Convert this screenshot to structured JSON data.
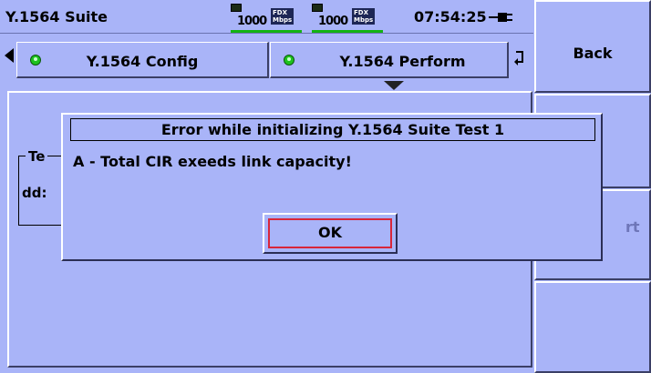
{
  "status_bar": {
    "app_title": "Y.1564 Suite",
    "ports": [
      {
        "speed": "1000",
        "duplex": "FDX",
        "units": "Mbps"
      },
      {
        "speed": "1000",
        "duplex": "FDX",
        "units": "Mbps"
      }
    ],
    "clock": "07:54:25",
    "port_status_color": "#13b313"
  },
  "tabs": [
    {
      "label": "Y.1564 Config",
      "led": "green"
    },
    {
      "label": "Y.1564 Perform",
      "led": "green"
    }
  ],
  "background_panel": {
    "group_title_partial": "Te",
    "group_text_partial": "dd:"
  },
  "softkeys": [
    {
      "label": "Back",
      "enabled": true
    },
    {
      "label": "",
      "enabled": true
    },
    {
      "label": "rt",
      "enabled": false
    },
    {
      "label": "",
      "enabled": true
    }
  ],
  "dialog": {
    "title": "Error while initializing Y.1564 Suite Test 1",
    "message": "A - Total CIR exeeds link capacity!",
    "ok_label": "OK"
  },
  "colors": {
    "background": "#a9b4f8",
    "led_green": "#1ec21e",
    "focus_red": "#d8263a"
  }
}
